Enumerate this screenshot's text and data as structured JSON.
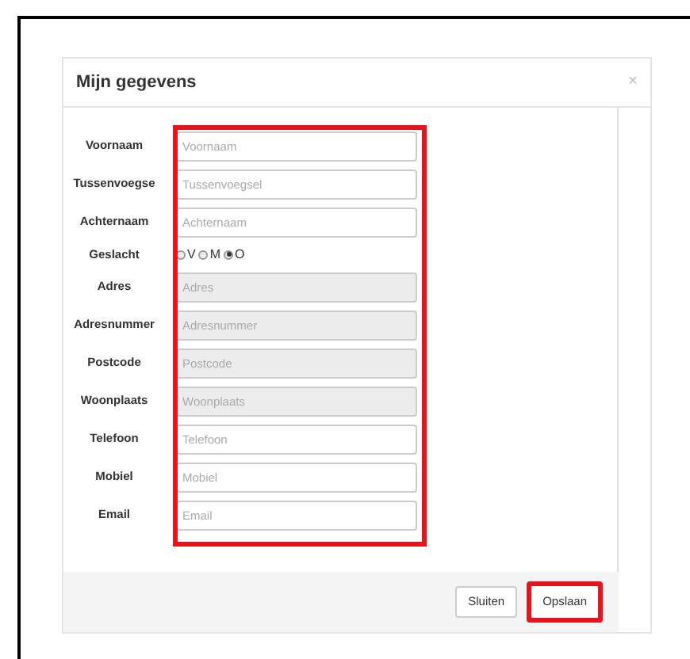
{
  "dialog": {
    "title": "Mijn gegevens",
    "close": "×"
  },
  "form": {
    "highlighted": true,
    "fields": [
      {
        "kind": "text",
        "label": "Voornaam",
        "placeholder": "Voornaam",
        "disabled": false
      },
      {
        "kind": "text",
        "label": "Tussenvoegse",
        "placeholder": "Tussenvoegsel",
        "disabled": false
      },
      {
        "kind": "text",
        "label": "Achternaam",
        "placeholder": "Achternaam",
        "disabled": false
      },
      {
        "kind": "radio",
        "label": "Geslacht",
        "options": [
          {
            "label": "V",
            "selected": false
          },
          {
            "label": "M",
            "selected": false
          },
          {
            "label": "O",
            "selected": true
          }
        ]
      },
      {
        "kind": "text",
        "label": "Adres",
        "placeholder": "Adres",
        "disabled": true
      },
      {
        "kind": "text",
        "label": "Adresnummer",
        "placeholder": "Adresnummer",
        "disabled": true
      },
      {
        "kind": "text",
        "label": "Postcode",
        "placeholder": "Postcode",
        "disabled": true
      },
      {
        "kind": "text",
        "label": "Woonplaats",
        "placeholder": "Woonplaats",
        "disabled": true
      },
      {
        "kind": "text",
        "label": "Telefoon",
        "placeholder": "Telefoon",
        "disabled": false
      },
      {
        "kind": "text",
        "label": "Mobiel",
        "placeholder": "Mobiel",
        "disabled": false
      },
      {
        "kind": "text",
        "label": "Email",
        "placeholder": "Email",
        "disabled": false
      }
    ]
  },
  "buttons": [
    {
      "label": "Sluiten",
      "highlighted": false
    },
    {
      "label": "Opslaan",
      "highlighted": true
    }
  ]
}
